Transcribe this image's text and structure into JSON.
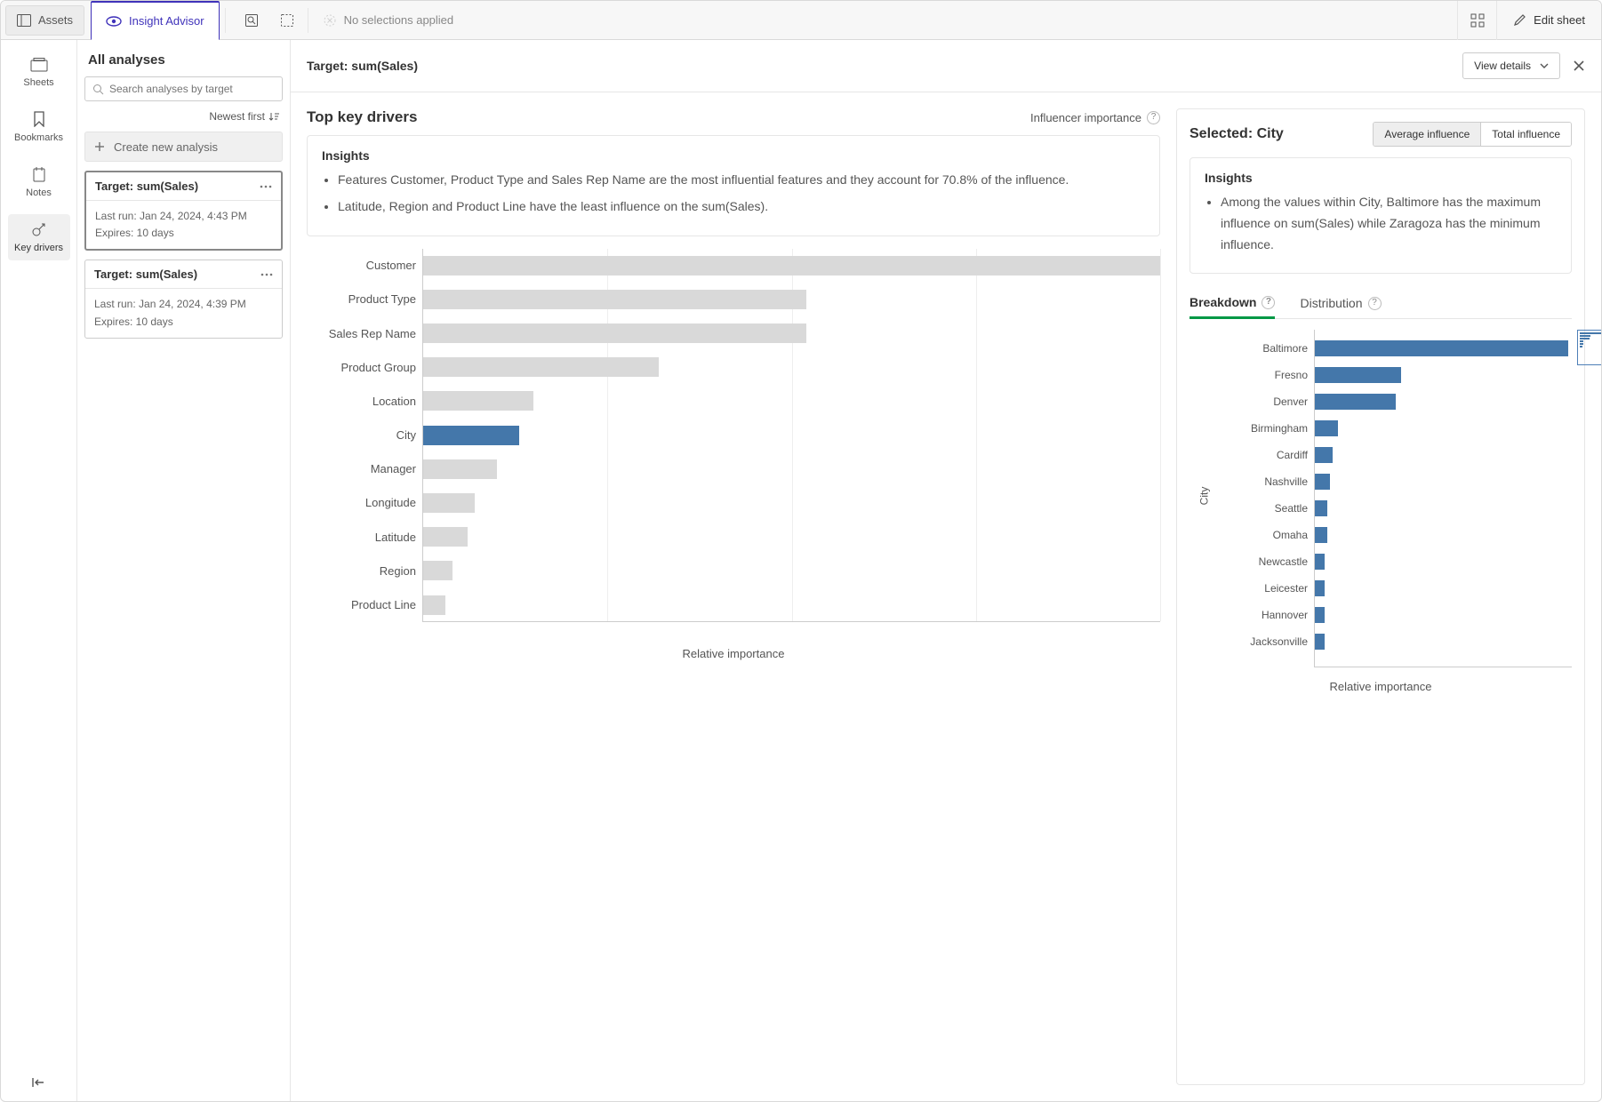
{
  "topbar": {
    "assets": "Assets",
    "insight": "Insight Advisor",
    "nosel": "No selections applied",
    "edit": "Edit sheet"
  },
  "rail": {
    "sheets": "Sheets",
    "bookmarks": "Bookmarks",
    "notes": "Notes",
    "keydrivers": "Key drivers"
  },
  "analyses": {
    "title": "All analyses",
    "search_ph": "Search analyses by target",
    "sort": "Newest first",
    "new": "Create new analysis",
    "items": [
      {
        "title": "Target: sum(Sales)",
        "last": "Last run: Jan 24, 2024, 4:43 PM",
        "exp": "Expires: 10 days"
      },
      {
        "title": "Target: sum(Sales)",
        "last": "Last run: Jan 24, 2024, 4:39 PM",
        "exp": "Expires: 10 days"
      }
    ]
  },
  "main": {
    "target": "Target: sum(Sales)",
    "view": "View details",
    "left_title": "Top key drivers",
    "left_sub": "Influencer importance",
    "insights_h": "Insights",
    "ins1": "Features Customer, Product Type and Sales Rep Name are the most influential features and they account for 70.8% of the influence.",
    "ins2": "Latitude, Region and Product Line have the least influence on the sum(Sales).",
    "xlabel": "Relative importance",
    "right_prefix": "Selected: ",
    "right_sel": "City",
    "seg_avg": "Average influence",
    "seg_tot": "Total influence",
    "right_ins": "Among the values within City, Baltimore has the maximum influence on sum(Sales) while Zaragoza has the minimum influence.",
    "tab_break": "Breakdown",
    "tab_dist": "Distribution",
    "yaxis2": "City"
  },
  "chart_data": [
    {
      "type": "bar",
      "orientation": "horizontal",
      "title": "Top key drivers",
      "xlabel": "Relative importance",
      "categories": [
        "Customer",
        "Product Type",
        "Sales Rep Name",
        "Product Group",
        "Location",
        "City",
        "Manager",
        "Longitude",
        "Latitude",
        "Region",
        "Product Line"
      ],
      "values": [
        100,
        52,
        52,
        32,
        15,
        13,
        10,
        7,
        6,
        4,
        3
      ],
      "highlighted": "City",
      "xlim": [
        0,
        100
      ]
    },
    {
      "type": "bar",
      "orientation": "horizontal",
      "title": "Breakdown by City",
      "xlabel": "Relative importance",
      "ylabel": "City",
      "categories": [
        "Baltimore",
        "Fresno",
        "Denver",
        "Birmingham",
        "Cardiff",
        "Nashville",
        "Seattle",
        "Omaha",
        "Newcastle",
        "Leicester",
        "Hannover",
        "Jacksonville"
      ],
      "values": [
        100,
        34,
        32,
        9,
        7,
        6,
        5,
        5,
        4,
        4,
        4,
        4
      ],
      "xlim": [
        0,
        100
      ]
    }
  ]
}
